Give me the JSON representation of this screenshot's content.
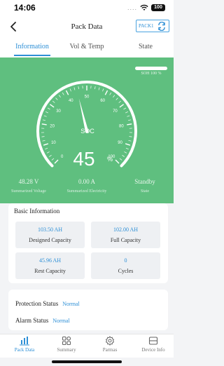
{
  "status_bar": {
    "time": "14:06",
    "battery": "100",
    "signal": "....",
    "icons": [
      "wifi-icon",
      "battery-icon"
    ]
  },
  "nav": {
    "title": "Pack Data",
    "back_icon": "chevron-left-icon",
    "pack_button": {
      "label": "PACK1",
      "icon": "swap-icon"
    }
  },
  "tabs": [
    {
      "label": "Information",
      "active": true
    },
    {
      "label": "Vol & Temp",
      "active": false
    },
    {
      "label": "State",
      "active": false
    }
  ],
  "gauge": {
    "label": "SOC",
    "value": "45",
    "unit": "%",
    "soc_fraction": 0.45,
    "ticks": [
      "0",
      "10",
      "20",
      "30",
      "40",
      "50",
      "60",
      "70",
      "80",
      "90",
      "100"
    ],
    "soh_text": "SOH 100 %",
    "soh_fraction": 1.0,
    "colors": {
      "background": "#5fbf7f",
      "dial": "#ffffff"
    }
  },
  "metrics": [
    {
      "value": "48.28 V",
      "label": "Summarized Voltage"
    },
    {
      "value": "0.00 A",
      "label": "Summarized Electricity"
    },
    {
      "value": "Standby",
      "label": "State"
    }
  ],
  "basic_info": {
    "title": "Basic Information",
    "cells": [
      {
        "value": "103.50 AH",
        "label": "Designed Capacity"
      },
      {
        "value": "102.00 AH",
        "label": "Full Capacity"
      },
      {
        "value": "45.96 AH",
        "label": "Rest Capacity"
      },
      {
        "value": "0",
        "label": "Cycles"
      }
    ]
  },
  "status": {
    "protection": {
      "label": "Protection Status",
      "value": "Normal"
    },
    "alarm": {
      "label": "Alarm Status",
      "value": "Normal"
    }
  },
  "bottom_nav": [
    {
      "label": "Pack Data",
      "icon": "bar-chart-icon",
      "active": true
    },
    {
      "label": "Summary",
      "icon": "grid-icon",
      "active": false
    },
    {
      "label": "Parmas",
      "icon": "gear-icon",
      "active": false
    },
    {
      "label": "Device Info",
      "icon": "device-icon",
      "active": false
    }
  ],
  "accent_color": "#2d8fd6"
}
